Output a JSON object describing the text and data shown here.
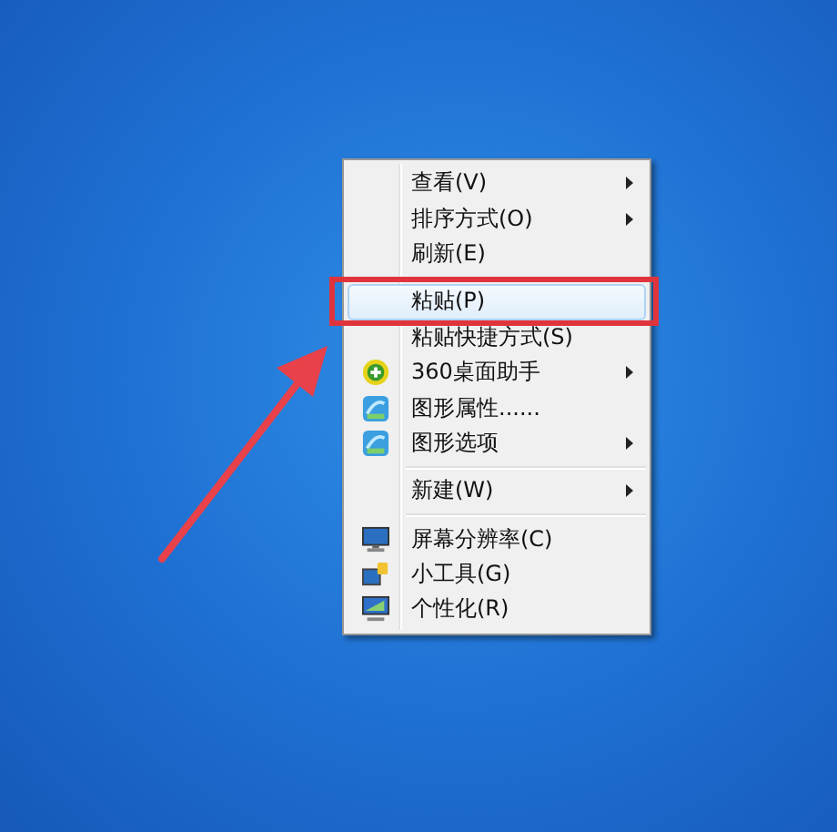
{
  "context_menu": {
    "items": [
      {
        "kind": "command",
        "label": "查看(V)",
        "submenu": true,
        "selected": false
      },
      {
        "kind": "command",
        "label": "排序方式(O)",
        "submenu": true,
        "selected": false
      },
      {
        "kind": "command",
        "label": "刷新(E)",
        "submenu": false,
        "selected": false
      },
      {
        "kind": "separator"
      },
      {
        "kind": "command",
        "label": "粘贴(P)",
        "submenu": false,
        "selected": true
      },
      {
        "kind": "command",
        "label": "粘贴快捷方式(S)",
        "submenu": false,
        "selected": false
      },
      {
        "kind": "command",
        "label": "360桌面助手",
        "submenu": true,
        "selected": false
      },
      {
        "kind": "command",
        "label": "图形属性......",
        "submenu": false,
        "selected": false
      },
      {
        "kind": "command",
        "label": "图形选项",
        "submenu": true,
        "selected": false
      },
      {
        "kind": "separator"
      },
      {
        "kind": "command",
        "label": "新建(W)",
        "submenu": true,
        "selected": false
      },
      {
        "kind": "separator"
      },
      {
        "kind": "command",
        "label": "屏幕分辨率(C)",
        "submenu": false,
        "selected": false
      },
      {
        "kind": "command",
        "label": "小工具(G)",
        "submenu": false,
        "selected": false
      },
      {
        "kind": "command",
        "label": "个性化(R)",
        "submenu": false,
        "selected": false
      }
    ]
  }
}
